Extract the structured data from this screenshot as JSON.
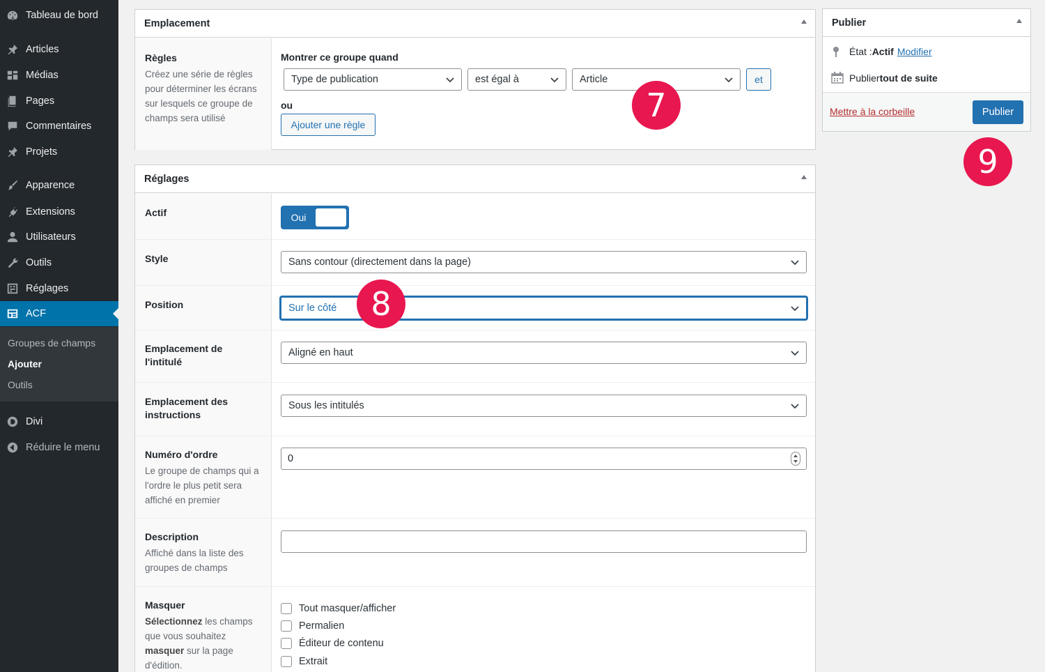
{
  "sidebar": {
    "items": [
      {
        "label": "Tableau de bord",
        "icon": "dashboard-icon"
      },
      {
        "label": "Articles",
        "icon": "pin-icon"
      },
      {
        "label": "Médias",
        "icon": "media-icon"
      },
      {
        "label": "Pages",
        "icon": "pages-icon"
      },
      {
        "label": "Commentaires",
        "icon": "comments-icon"
      },
      {
        "label": "Projets",
        "icon": "pin-icon"
      },
      {
        "label": "Apparence",
        "icon": "brush-icon"
      },
      {
        "label": "Extensions",
        "icon": "plugin-icon"
      },
      {
        "label": "Utilisateurs",
        "icon": "users-icon"
      },
      {
        "label": "Outils",
        "icon": "wrench-icon"
      },
      {
        "label": "Réglages",
        "icon": "settings-icon"
      },
      {
        "label": "ACF",
        "icon": "acf-icon"
      }
    ],
    "submenu": [
      "Groupes de champs",
      "Ajouter",
      "Outils"
    ],
    "divi": "Divi",
    "collapse": "Réduire le menu"
  },
  "location": {
    "title": "Emplacement",
    "rules_label": "Règles",
    "rules_desc": "Créez une série de règles pour déterminer les écrans sur lesquels ce groupe de champs sera utilisé",
    "show_when": "Montrer ce groupe quand",
    "param": "Type de publication",
    "operator": "est égal à",
    "value": "Article",
    "and_button": "et",
    "or_label": "ou",
    "add_rule": "Ajouter une règle"
  },
  "settings": {
    "title": "Réglages",
    "active_label": "Actif",
    "active_value": "Oui",
    "style_label": "Style",
    "style_value": "Sans contour (directement dans la page)",
    "position_label": "Position",
    "position_value": "Sur le côté",
    "label_placement_label": "Emplacement de l'intitulé",
    "label_placement_value": "Aligné en haut",
    "instruction_label": "Emplacement des instructions",
    "instruction_value": "Sous les intitulés",
    "order_label": "Numéro d'ordre",
    "order_desc": "Le groupe de champs qui a l'ordre le plus petit sera affiché en premier",
    "order_value": "0",
    "description_label": "Description",
    "description_desc": "Affiché dans la liste des groupes de champs",
    "hide_label": "Masquer",
    "hide_desc_1": "Sélectionnez",
    "hide_desc_2": " les champs que vous souhaitez ",
    "hide_desc_3": "masquer",
    "hide_desc_4": " sur la page d'édition.",
    "hide_options": [
      "Tout masquer/afficher",
      "Permalien",
      "Éditeur de contenu",
      "Extrait"
    ]
  },
  "publish": {
    "title": "Publier",
    "status_prefix": "État : ",
    "status_value": "Actif",
    "status_edit": "Modifier",
    "schedule_prefix": "Publier ",
    "schedule_value": "tout de suite",
    "trash": "Mettre à la corbeille",
    "publish_button": "Publier"
  },
  "badges": [
    "7",
    "8",
    "9"
  ],
  "colors": {
    "accent": "#2271b1",
    "sidebar": "#23282d",
    "badge": "#e8174f",
    "danger": "#b32d2e"
  }
}
